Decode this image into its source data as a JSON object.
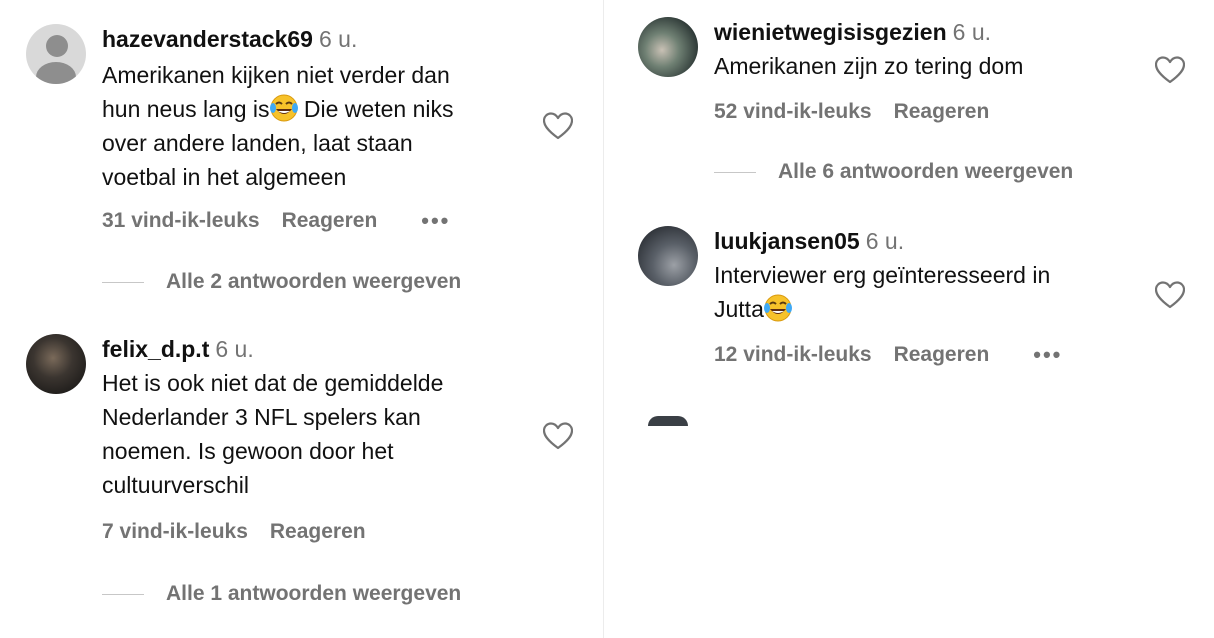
{
  "comments": [
    {
      "username": "hazevanderstack69",
      "time": "6 u.",
      "lines": [
        "Amerikanen kijken niet verder dan",
        "hun neus lang is",
        " Die weten niks",
        "over andere landen, laat staan",
        "voetbal in het algemeen"
      ],
      "likes": "31 vind-ik-leuks",
      "reply_label": "Reageren",
      "more": "•••",
      "view_replies": "Alle 2 antwoorden weergeven"
    },
    {
      "username": "felix_d.p.t",
      "time": "6 u.",
      "lines": [
        "Het is ook niet dat de gemiddelde",
        "Nederlander 3 NFL spelers kan",
        "noemen. Is gewoon door het",
        "cultuurverschil"
      ],
      "likes": "7 vind-ik-leuks",
      "reply_label": "Reageren",
      "view_replies": "Alle 1 antwoorden weergeven"
    },
    {
      "username": "wienietwegisisgezien",
      "time": "6 u.",
      "lines": [
        "Amerikanen zijn zo tering dom"
      ],
      "likes": "52 vind-ik-leuks",
      "reply_label": "Reageren",
      "view_replies": "Alle 6 antwoorden weergeven"
    },
    {
      "username": "luukjansen05",
      "time": "6 u.",
      "lines": [
        "Interviewer erg geïnteresseerd in",
        "Jutta"
      ],
      "likes": "12 vind-ik-leuks",
      "reply_label": "Reageren",
      "more": "•••"
    }
  ],
  "icons": {
    "like": "heart-outline-icon",
    "emoji": "face-with-tears-of-joy-icon",
    "more": "more-options-icon"
  },
  "colors": {
    "text": "#111111",
    "secondary": "#737373",
    "divider": "#ececec"
  }
}
